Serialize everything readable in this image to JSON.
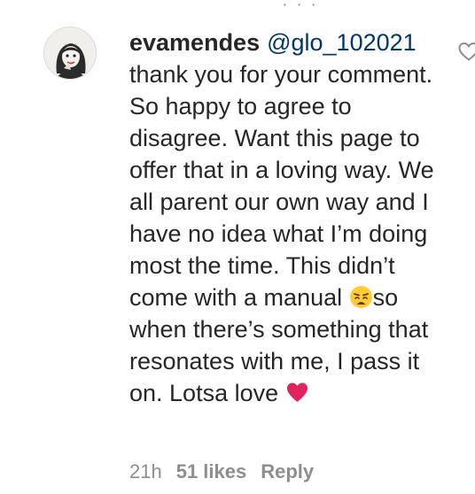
{
  "comment": {
    "username": "evamendes",
    "mention": "@glo_102021",
    "text_part1": "thank you for your comment. So happy to agree to disagree. Want this page to offer that in a loving way. We all parent our own way and I have no idea what I’m doing most the time. This didn’t come with a manual ",
    "text_part2": "so when there’s something that resonates with me, I pass it on. Lotsa love ",
    "emoji_1": "weary-face-emoji",
    "emoji_2": "red-heart-emoji"
  },
  "meta": {
    "time": "21h",
    "likes": "51 likes",
    "reply": "Reply"
  },
  "icons": {
    "like": "heart-outline-icon",
    "avatar": "profile-avatar"
  },
  "colors": {
    "text": "#262626",
    "mention": "#00376b",
    "secondary": "#8e8e8e",
    "heart_emoji": "#e0245e"
  }
}
